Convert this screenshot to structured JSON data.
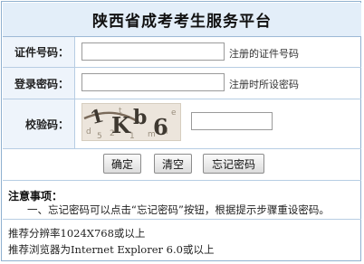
{
  "header": {
    "title": "陕西省成考考生服务平台"
  },
  "form": {
    "id_label": "证件号码：",
    "id_value": "",
    "id_hint": "注册的证件号码",
    "password_label": "登录密码：",
    "password_value": "",
    "password_hint": "注册时所设密码",
    "captcha_label": "校验码：",
    "captcha_value": "",
    "captcha_text": "1Kb6"
  },
  "buttons": {
    "confirm_label": "确定",
    "clear_label": "清空",
    "forgot_label": "忘记密码"
  },
  "notice": {
    "title": "注意事项：",
    "line1": "一、忘记密码可以点击“忘记密码”按钮，根据提示步骤重设密码。"
  },
  "footer": {
    "line1": "推荐分辨率1024X768或以上",
    "line2": "推荐浏览器为Internet Explorer 6.0或以上"
  },
  "colors": {
    "header_bg": "#e3eef9",
    "border": "#8fb0cf",
    "label_bg": "#eef4fb"
  }
}
